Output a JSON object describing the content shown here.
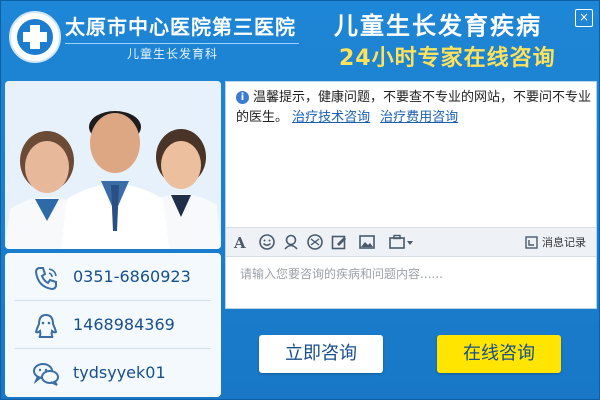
{
  "header": {
    "hospital_name": "太原市中心医院第三医院",
    "department": "儿童生长发育科",
    "slogan_line1": "儿童生长发育疾病",
    "slogan_line2": "24小时专家在线咨询",
    "close_label": "×"
  },
  "contacts": [
    {
      "icon": "phone-icon",
      "value": "0351-6860923"
    },
    {
      "icon": "qq-icon",
      "value": "1468984369"
    },
    {
      "icon": "wechat-icon",
      "value": "tydsyyek01"
    }
  ],
  "chat": {
    "tip_text": "温馨提示，健康问题，不要查不专业的网站，不要问不专业的医生。",
    "link_tech": "治疗技术咨询",
    "link_cost": "治疗费用咨询",
    "history_label": "消息记录",
    "input_placeholder": "请输入您要咨询的疾病和问题内容......"
  },
  "buttons": {
    "consult_now": "立即咨询",
    "online_consult": "在线咨询"
  },
  "colors": {
    "brand_blue": "#1878c7",
    "accent_yellow": "#ffe500",
    "link_blue": "#1a5fb4"
  }
}
